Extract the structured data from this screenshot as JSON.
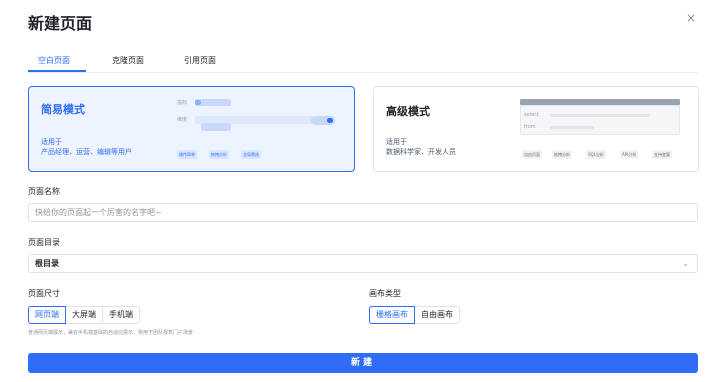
{
  "dialog": {
    "title": "新建页面",
    "close_icon": "×"
  },
  "tabs": [
    {
      "label": "空白页面",
      "active": true
    },
    {
      "label": "克隆页面",
      "active": false
    },
    {
      "label": "引用页面",
      "active": false
    }
  ],
  "modes": {
    "simple": {
      "title": "简易模式",
      "desc_line1": "适用于",
      "desc_line2": "产品经理、运营、编辑等用户",
      "preview_label_metric": "指标",
      "preview_label_dimension": "维度",
      "tags": [
        "操作简单",
        "拖拽分析",
        "全局筛选"
      ]
    },
    "advanced": {
      "title": "高级模式",
      "desc_line1": "适用于",
      "desc_line2": "数据科学家、开发人员",
      "preview_select": "select",
      "preview_from": "from",
      "tags": [
        "自由页面",
        "拖拽分析",
        "SQL分析",
        "API分析",
        "支持变量"
      ]
    }
  },
  "form": {
    "name_label": "页面名称",
    "name_placeholder": "快给你的页面起一个厉害的名字吧~",
    "dir_label": "页面目录",
    "dir_value": "根目录",
    "size_label": "页面尺寸",
    "size_options": [
      "网页端",
      "大屏端",
      "手机端"
    ],
    "size_selected": "网页端",
    "size_hint": "普通网页端展示，兼容手机端基础的自适应展示，常用于团队报表门户场景",
    "canvas_label": "画布类型",
    "canvas_options": [
      "栅格画布",
      "自由画布"
    ],
    "canvas_selected": "栅格画布",
    "submit_label": "新建"
  },
  "colors": {
    "accent": "#2f6df6",
    "accent_bg": "#eef4ff",
    "border": "#dfe2e7"
  }
}
